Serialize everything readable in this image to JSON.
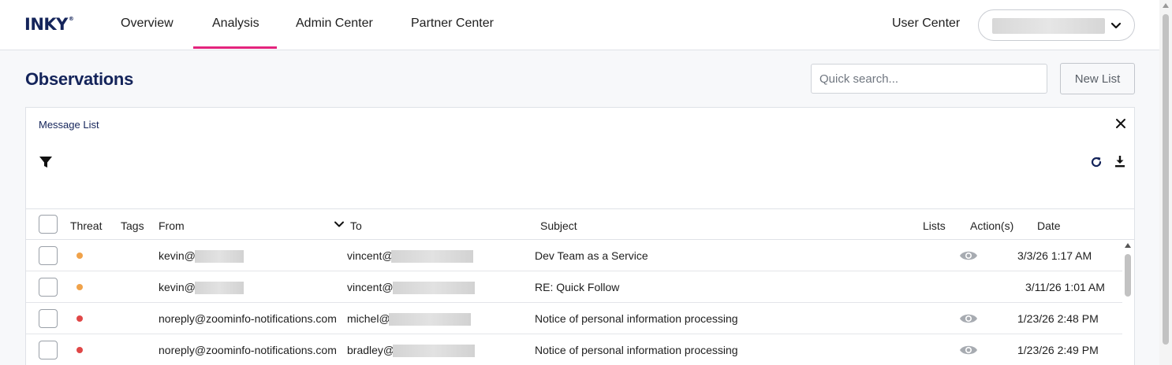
{
  "brand": {
    "logo": "INKY",
    "logo_mark": "®"
  },
  "nav": {
    "items": [
      {
        "label": "Overview"
      },
      {
        "label": "Analysis",
        "active": true
      },
      {
        "label": "Admin Center"
      },
      {
        "label": "Partner Center"
      }
    ],
    "user_center": "User Center",
    "accent_color": "#e3247d"
  },
  "page": {
    "title": "Observations",
    "search_placeholder": "Quick search...",
    "new_list_label": "New List"
  },
  "panel": {
    "title": "Message List",
    "columns": {
      "threat": "Threat",
      "tags": "Tags",
      "from": "From",
      "to": "To",
      "subject": "Subject",
      "lists": "Lists",
      "actions": "Action(s)",
      "date": "Date"
    },
    "rows": [
      {
        "threat_color": "#f0a24a",
        "from": "kevin@",
        "to": "vincent@",
        "subject": "Dev Team as a Service",
        "action": "eye-icon",
        "date": "3/3/26 1:17 AM"
      },
      {
        "threat_color": "#f0a24a",
        "from": "kevin@",
        "to": "vincent@",
        "subject": "RE: Quick Follow",
        "action": "",
        "date": "3/11/26 1:01 AM"
      },
      {
        "threat_color": "#e04747",
        "from": "noreply@zoominfo-notifications.com",
        "to": "michel@",
        "subject": "Notice of personal information processing",
        "action": "eye-icon",
        "date": "1/23/26 2:48 PM"
      },
      {
        "threat_color": "#e04747",
        "from": "noreply@zoominfo-notifications.com",
        "to": "bradley@",
        "subject": "Notice of personal information processing",
        "action": "eye-icon",
        "date": "1/23/26 2:49 PM"
      }
    ]
  }
}
